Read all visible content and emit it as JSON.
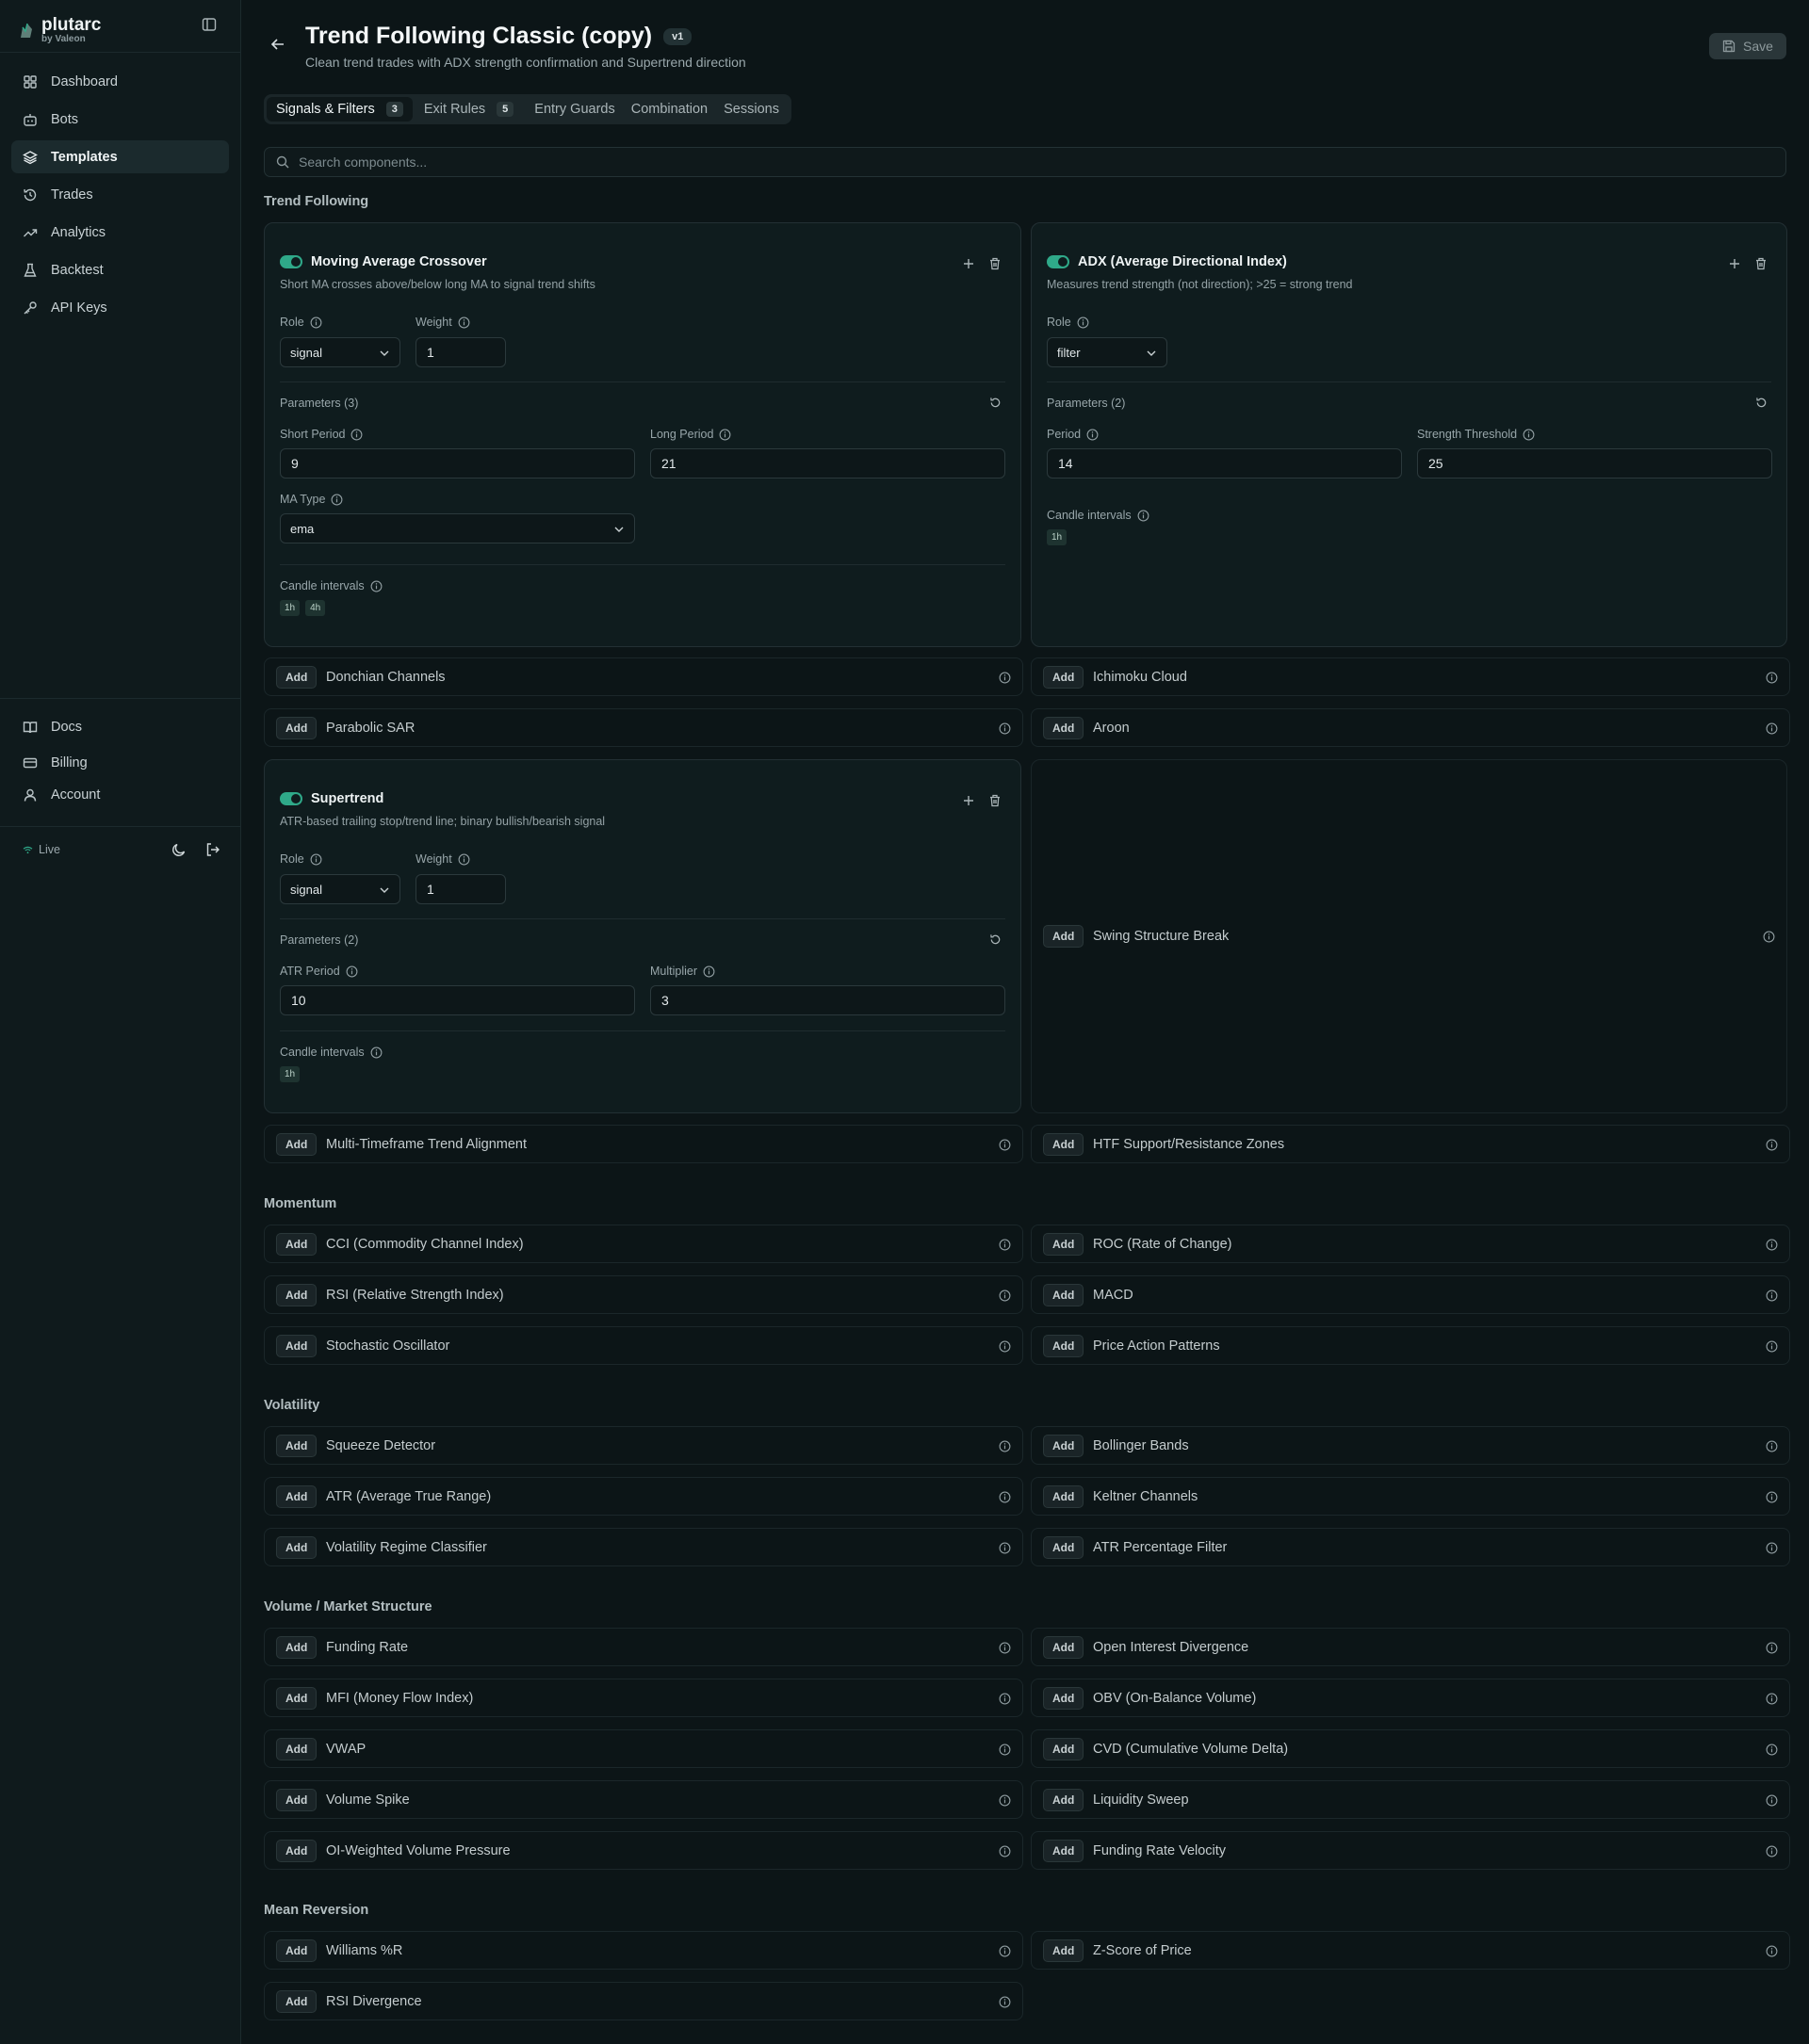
{
  "sidebar": {
    "brand": {
      "name": "plutarc",
      "sub": "by Valeon"
    },
    "nav": [
      {
        "label": "Dashboard",
        "icon": "grid-icon"
      },
      {
        "label": "Bots",
        "icon": "bot-icon"
      },
      {
        "label": "Templates",
        "icon": "layers-icon",
        "active": true
      },
      {
        "label": "Trades",
        "icon": "history-icon"
      },
      {
        "label": "Analytics",
        "icon": "trending-up-icon"
      },
      {
        "label": "Backtest",
        "icon": "flask-icon"
      },
      {
        "label": "API Keys",
        "icon": "key-icon"
      }
    ],
    "bottom_nav": [
      {
        "label": "Docs",
        "icon": "book-icon"
      },
      {
        "label": "Billing",
        "icon": "credit-card-icon"
      },
      {
        "label": "Account",
        "icon": "user-icon"
      }
    ],
    "status": "Live"
  },
  "header": {
    "title": "Trend Following Classic (copy)",
    "version": "v1",
    "subtitle": "Clean trend trades with ADX strength confirmation and Supertrend direction",
    "save_label": "Save"
  },
  "tabs": [
    {
      "label": "Signals & Filters",
      "count": "3",
      "active": true
    },
    {
      "label": "Exit Rules",
      "count": "5"
    },
    {
      "label": "Entry Guards",
      "count": ""
    },
    {
      "label": "Combination",
      "count": ""
    },
    {
      "label": "Sessions",
      "count": ""
    }
  ],
  "search": {
    "placeholder": "Search components..."
  },
  "labels": {
    "role": "Role",
    "weight": "Weight",
    "candle_intervals": "Candle intervals",
    "add": "Add"
  },
  "sections": {
    "trend": "Trend Following",
    "momentum": "Momentum",
    "volatility": "Volatility",
    "volume": "Volume / Market Structure",
    "mean_reversion": "Mean Reversion"
  },
  "cards": {
    "mac": {
      "name": "Moving Average Crossover",
      "desc": "Short MA crosses above/below long MA to signal trend shifts",
      "role": "signal",
      "weight": "1",
      "params_label": "Parameters (3)",
      "p1_label": "Short Period",
      "p1_value": "9",
      "p2_label": "Long Period",
      "p2_value": "21",
      "p3_label": "MA Type",
      "p3_value": "ema",
      "intervals": [
        "1h",
        "4h"
      ]
    },
    "adx": {
      "name": "ADX (Average Directional Index)",
      "desc": "Measures trend strength (not direction); >25 = strong trend",
      "role": "filter",
      "params_label": "Parameters (2)",
      "p1_label": "Period",
      "p1_value": "14",
      "p2_label": "Strength Threshold",
      "p2_value": "25",
      "intervals": [
        "1h"
      ]
    },
    "st": {
      "name": "Supertrend",
      "desc": "ATR-based trailing stop/trend line; binary bullish/bearish signal",
      "role": "signal",
      "weight": "1",
      "params_label": "Parameters (2)",
      "p1_label": "ATR Period",
      "p1_value": "10",
      "p2_label": "Multiplier",
      "p2_value": "3",
      "intervals": [
        "1h"
      ]
    }
  },
  "components": {
    "donchian": "Donchian Channels",
    "ichimoku": "Ichimoku Cloud",
    "psar": "Parabolic SAR",
    "aroon": "Aroon",
    "swing": "Swing Structure Break",
    "mtf": "Multi-Timeframe Trend Alignment",
    "htf": "HTF Support/Resistance Zones",
    "cci": "CCI (Commodity Channel Index)",
    "roc": "ROC (Rate of Change)",
    "rsi": "RSI (Relative Strength Index)",
    "macd": "MACD",
    "stoch": "Stochastic Oscillator",
    "pap": "Price Action Patterns",
    "squeeze": "Squeeze Detector",
    "bb": "Bollinger Bands",
    "atr": "ATR (Average True Range)",
    "keltner": "Keltner Channels",
    "vrc": "Volatility Regime Classifier",
    "atrpf": "ATR Percentage Filter",
    "funding": "Funding Rate",
    "oid": "Open Interest Divergence",
    "mfi": "MFI (Money Flow Index)",
    "obv": "OBV (On-Balance Volume)",
    "vwap": "VWAP",
    "cvd": "CVD (Cumulative Volume Delta)",
    "vspike": "Volume Spike",
    "lsweep": "Liquidity Sweep",
    "oiw": "OI-Weighted Volume Pressure",
    "frv": "Funding Rate Velocity",
    "wr": "Williams %R",
    "zscore": "Z-Score of Price",
    "rsidiv": "RSI Divergence"
  },
  "colors": {
    "background": "#0c1517",
    "accent": "#2fa989",
    "card": "#0f1c1e"
  }
}
